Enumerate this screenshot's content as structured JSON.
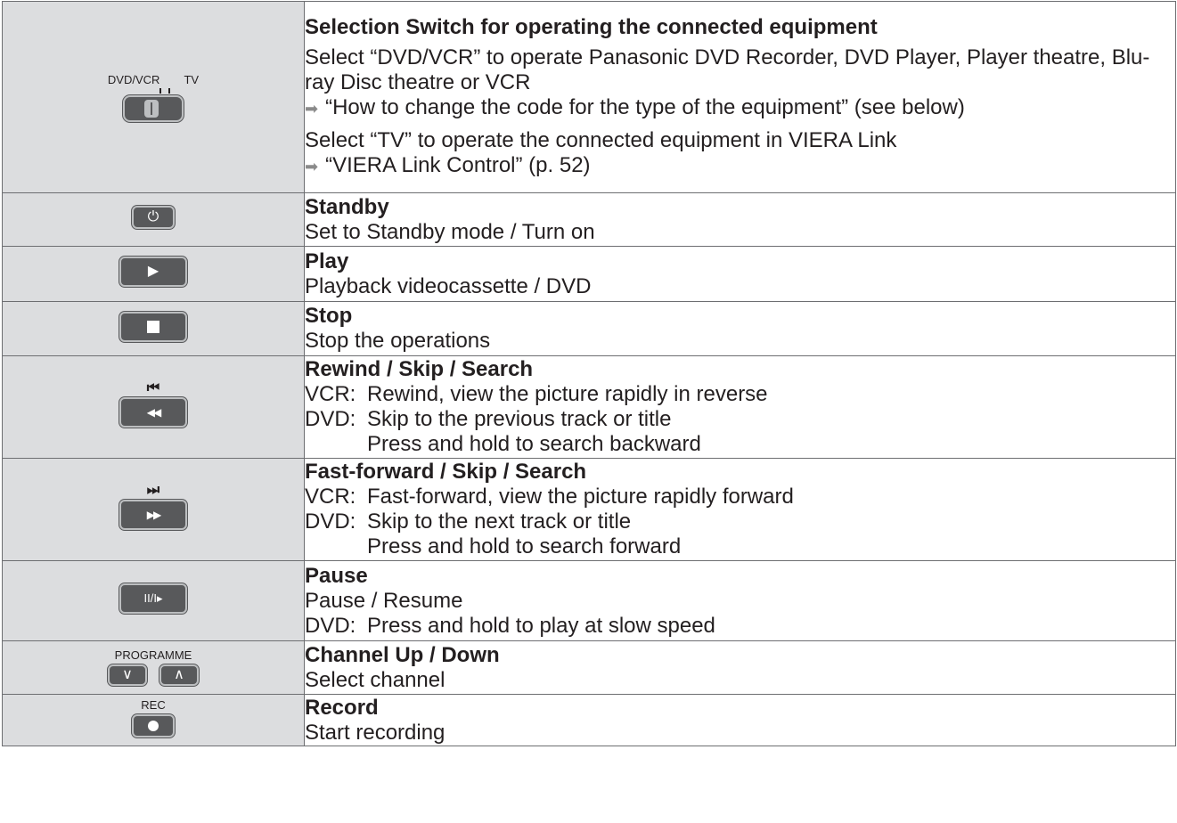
{
  "rows": [
    {
      "title": "Selection Switch for operating the connected equipment",
      "dvd_paragraph": "Select “DVD/VCR” to operate Panasonic DVD Recorder, DVD Player, Player theatre, Blu-ray Disc theatre or VCR",
      "dvd_ref": "“How to change the code for the type of the equipment” (see below)",
      "tv_paragraph": "Select “TV” to operate the connected equipment in VIERA Link",
      "tv_ref": "“VIERA Link Control” (p. 52)",
      "switch_label_left": "DVD/VCR",
      "switch_label_right": "TV"
    },
    {
      "title": "Standby",
      "line1": "Set to Standby mode / Turn on"
    },
    {
      "title": "Play",
      "line1": "Playback videocassette / DVD"
    },
    {
      "title": "Stop",
      "line1": "Stop the operations"
    },
    {
      "title": "Rewind / Skip / Search",
      "vcr_label": "VCR:",
      "vcr_text": "Rewind, view the picture rapidly in reverse",
      "dvd_label": "DVD:",
      "dvd_text": "Skip to the previous track or title",
      "dvd_text2": "Press and hold to search backward"
    },
    {
      "title": "Fast-forward / Skip / Search",
      "vcr_label": "VCR:",
      "vcr_text": "Fast-forward, view the picture rapidly forward",
      "dvd_label": "DVD:",
      "dvd_text": "Skip to the next track or title",
      "dvd_text2": "Press and hold to search forward"
    },
    {
      "title": "Pause",
      "line1": "Pause / Resume",
      "dvd_label": "DVD:",
      "dvd_text": "Press and hold to play at slow speed"
    },
    {
      "title": "Channel Up / Down",
      "line1": "Select channel",
      "button_label": "PROGRAMME"
    },
    {
      "title": "Record",
      "line1": "Start recording",
      "button_label": "REC"
    }
  ],
  "icons": {
    "arrow": "➡",
    "standby": "⏻",
    "play": "▶",
    "skip_prev": "⏮",
    "rewind": "◀◀",
    "skip_next": "⏭",
    "fast_forward": "▶▶",
    "pause_slow": "II/I▸",
    "down": "∨",
    "up": "∧"
  },
  "colors": {
    "icon_cell_bg": "#dcdddf",
    "button_fill": "#58595b",
    "border": "#6d6e71"
  }
}
